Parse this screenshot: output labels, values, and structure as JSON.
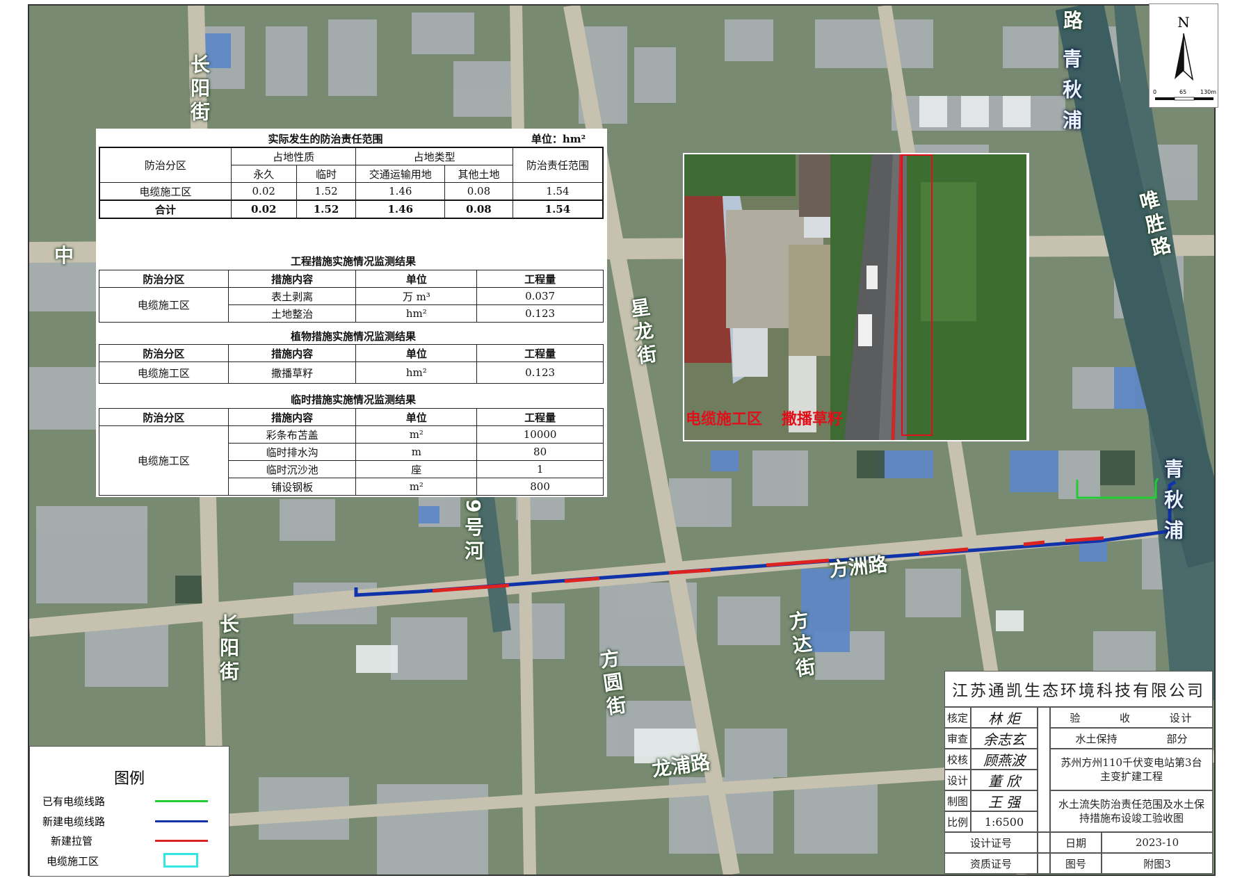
{
  "roads": {
    "changyang_top": "长阳街",
    "changyang_bottom": "长阳街",
    "zhong": "中",
    "xinglong": "星龙街",
    "fangzhou": "方洲路",
    "fangyuan": "方圆街",
    "fangda": "方达街",
    "longpu": "龙浦路",
    "weisheng": "唯胜路",
    "top_right_lu": "路",
    "river9": "9号河"
  },
  "rivers": {
    "qingqiupu_top": "青秋浦",
    "qingqiupu_bottom": "青秋浦"
  },
  "north_arrow": {
    "letter": "N",
    "scale_ticks": [
      "0",
      "65",
      "130m"
    ]
  },
  "table1": {
    "title": "实际发生的防治责任范围",
    "unit": "单位：hm²",
    "col_zone": "防治分区",
    "col_occupy_nature": "占地性质",
    "col_occupy_type": "占地类型",
    "col_scope": "防治责任范围",
    "col_permanent": "永久",
    "col_temporary": "临时",
    "col_traffic": "交通运输用地",
    "col_other": "其他土地",
    "rows": [
      {
        "zone": "电缆施工区",
        "permanent": "0.02",
        "temporary": "1.52",
        "traffic": "1.46",
        "other": "0.08",
        "scope": "1.54"
      }
    ],
    "total": {
      "zone": "合计",
      "permanent": "0.02",
      "temporary": "1.52",
      "traffic": "1.46",
      "other": "0.08",
      "scope": "1.54"
    }
  },
  "table2": {
    "title": "工程措施实施情况监测结果",
    "headers": [
      "防治分区",
      "措施内容",
      "单位",
      "工程量"
    ],
    "zone": "电缆施工区",
    "rows": [
      {
        "measure": "表土剥离",
        "unit": "万 m³",
        "qty": "0.037"
      },
      {
        "measure": "土地整治",
        "unit": "hm²",
        "qty": "0.123"
      }
    ]
  },
  "table3": {
    "title": "植物措施实施情况监测结果",
    "headers": [
      "防治分区",
      "措施内容",
      "单位",
      "工程量"
    ],
    "zone": "电缆施工区",
    "rows": [
      {
        "measure": "撒播草籽",
        "unit": "hm²",
        "qty": "0.123"
      }
    ]
  },
  "table4": {
    "title": "临时措施实施情况监测结果",
    "headers": [
      "防治分区",
      "措施内容",
      "单位",
      "工程量"
    ],
    "zone": "电缆施工区",
    "rows": [
      {
        "measure": "彩条布苫盖",
        "unit": "m²",
        "qty": "10000"
      },
      {
        "measure": "临时排水沟",
        "unit": "m",
        "qty": "80"
      },
      {
        "measure": "临时沉沙池",
        "unit": "座",
        "qty": "1"
      },
      {
        "measure": "铺设钢板",
        "unit": "m²",
        "qty": "800"
      }
    ]
  },
  "photo": {
    "caption_left": "电缆施工区",
    "caption_right": "撒播草籽"
  },
  "legend": {
    "title": "图例",
    "items": [
      {
        "label": "已有电缆线路",
        "color": "#22cc33"
      },
      {
        "label": "新建电缆线路",
        "color": "#1133aa"
      },
      {
        "label": "新建拉管",
        "color": "#dd2222"
      },
      {
        "label": "电缆施工区",
        "color": "#33e6e6"
      }
    ]
  },
  "title_block": {
    "company": "江苏通凯生态环境科技有限公司",
    "labels": [
      "核定",
      "审查",
      "校核",
      "设计",
      "制图",
      "比例"
    ],
    "signatures": [
      "林 炬",
      "余志玄",
      "顾燕波",
      "董 欣",
      "王 强"
    ],
    "scale": "1:6500",
    "stage": [
      "验",
      "收",
      "设计"
    ],
    "dept": [
      "水土保持",
      "部分"
    ],
    "project": "苏州方州110千伏变电站第3台主变扩建工程",
    "drawing": "水土流失防治责任范围及水土保持措施布设竣工验收图",
    "design_cert": "设计证号",
    "quality_cert": "资质证号",
    "date_label": "日期",
    "date": "2023-10",
    "fig_label": "图号",
    "fig_no": "附图3"
  },
  "colors": {
    "existing_cable": "#22cc33",
    "new_cable": "#1133aa",
    "new_pull_pipe": "#dd2222",
    "construction_zone": "#33e6e6",
    "caption_red": "#e0101a"
  }
}
